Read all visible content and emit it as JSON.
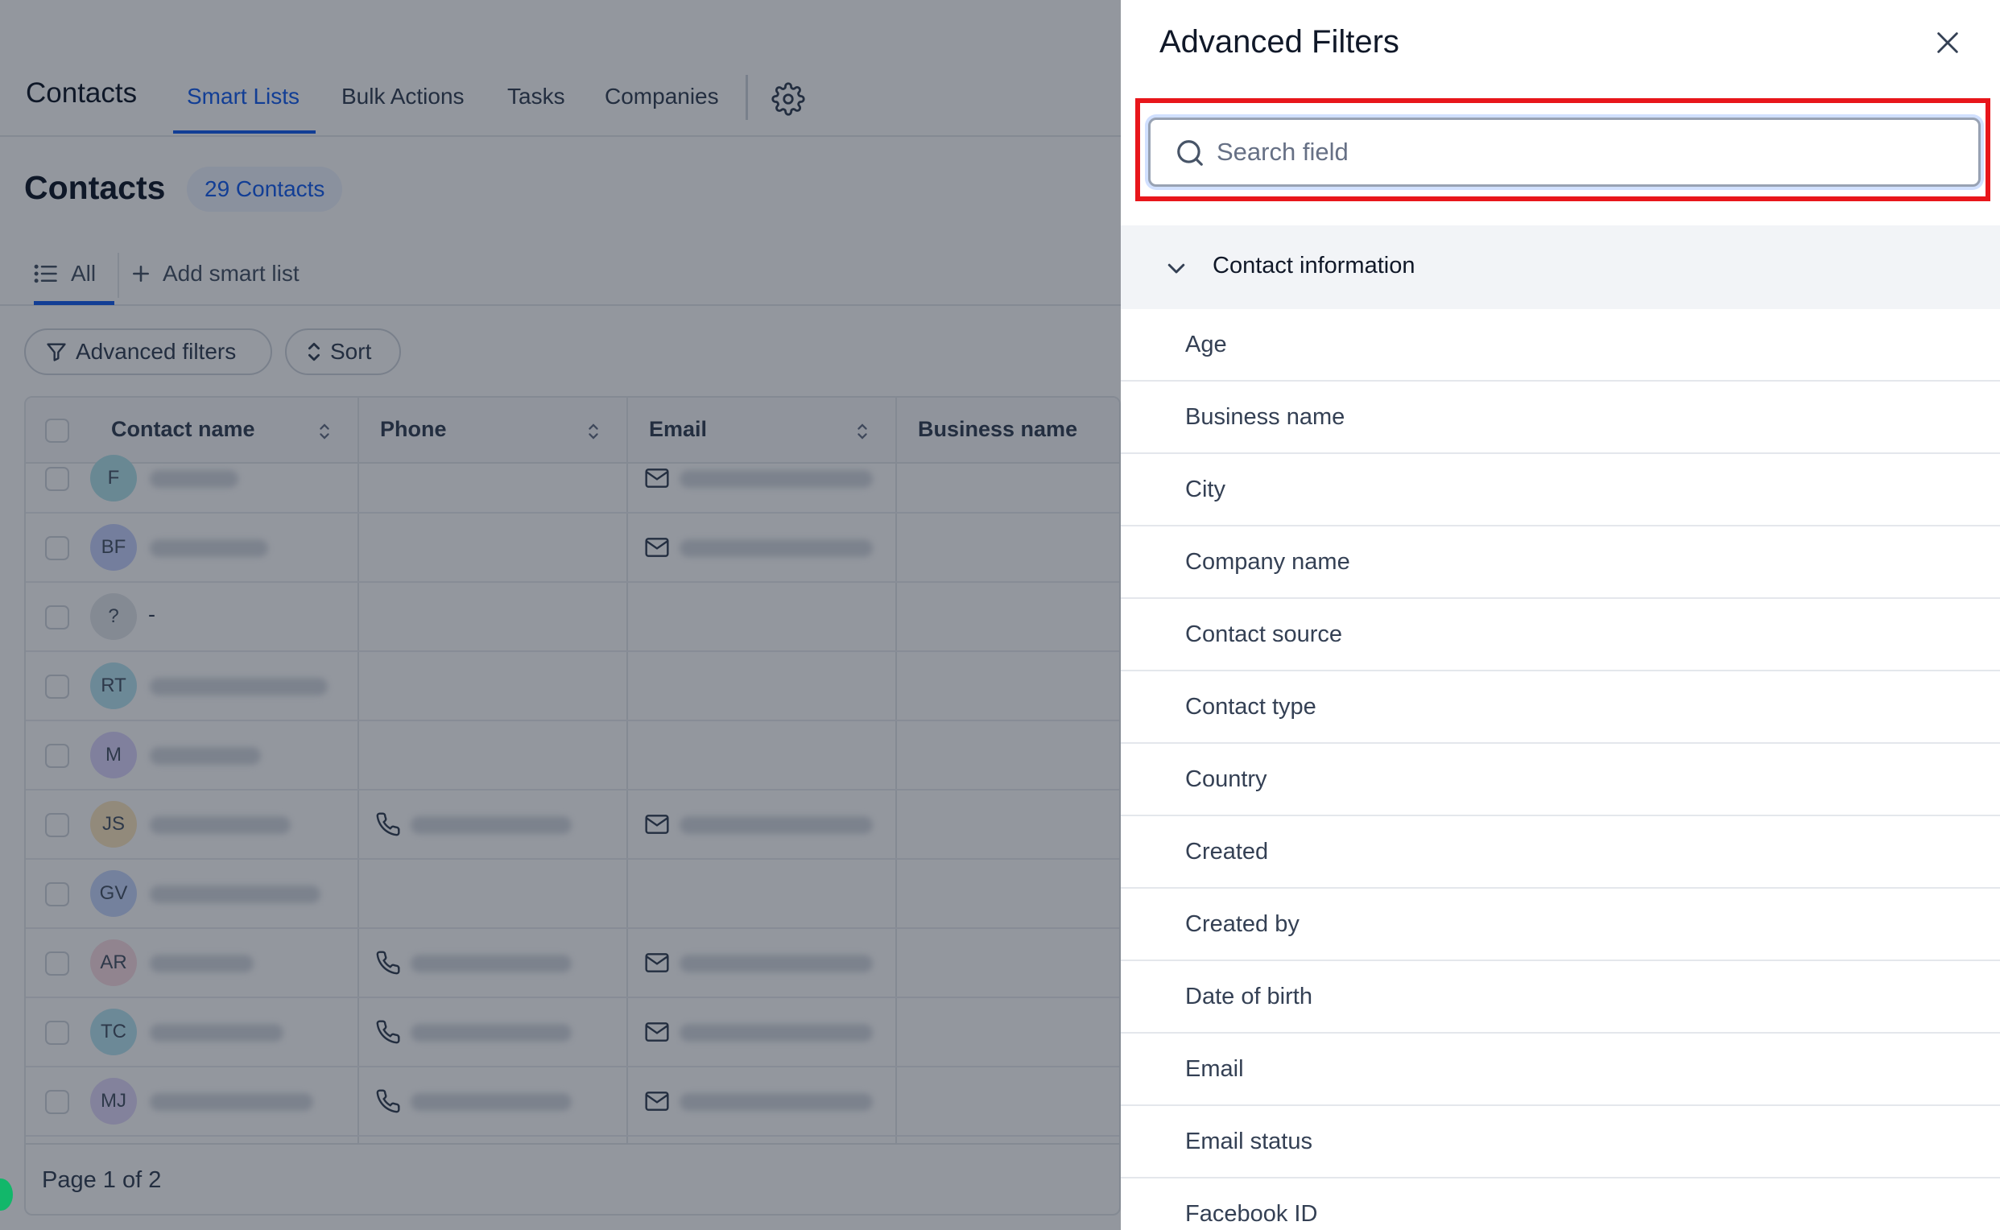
{
  "topnav": {
    "title": "Contacts",
    "tabs": [
      {
        "label": "Smart Lists",
        "active": true
      },
      {
        "label": "Bulk Actions"
      },
      {
        "label": "Tasks"
      },
      {
        "label": "Companies"
      }
    ],
    "settings_icon": "gear-icon"
  },
  "page": {
    "title": "Contacts",
    "count_badge": "29 Contacts"
  },
  "list_tabs": {
    "all_label": "All",
    "add_label": "Add smart list"
  },
  "toolbar": {
    "advanced_filters_label": "Advanced filters",
    "sort_label": "Sort"
  },
  "table": {
    "columns": [
      "Contact name",
      "Phone",
      "Email",
      "Business name"
    ],
    "rows": [
      {
        "initials": "F",
        "avatar_color": "#b3e3ec",
        "has_phone": false,
        "has_email": true
      },
      {
        "initials": "BF",
        "avatar_color": "#c7d2fe",
        "has_phone": false,
        "has_email": true
      },
      {
        "initials": "?",
        "avatar_color": "#e4e7ec",
        "name_text": "-",
        "has_phone": false,
        "has_email": false
      },
      {
        "initials": "RT",
        "avatar_color": "#b9e6f2",
        "has_phone": false,
        "has_email": false
      },
      {
        "initials": "M",
        "avatar_color": "#ddd6fe",
        "has_phone": false,
        "has_email": false
      },
      {
        "initials": "JS",
        "avatar_color": "#fde7c0",
        "has_phone": true,
        "has_email": true
      },
      {
        "initials": "GV",
        "avatar_color": "#c7d7fe",
        "has_phone": false,
        "has_email": false
      },
      {
        "initials": "AR",
        "avatar_color": "#fbdde3",
        "has_phone": true,
        "has_email": true
      },
      {
        "initials": "TC",
        "avatar_color": "#b9e6f2",
        "has_phone": true,
        "has_email": true
      },
      {
        "initials": "MJ",
        "avatar_color": "#e2d9fc",
        "has_phone": true,
        "has_email": true
      }
    ],
    "pagination": "Page 1 of 2"
  },
  "drawer": {
    "title": "Advanced Filters",
    "search_placeholder": "Search field",
    "search_value": "",
    "section_label": "Contact information",
    "fields": [
      "Age",
      "Business name",
      "City",
      "Company name",
      "Contact source",
      "Contact type",
      "Country",
      "Created",
      "Created by",
      "Date of birth",
      "Email",
      "Email status",
      "Facebook ID"
    ]
  },
  "colors": {
    "accent": "#155eef",
    "highlight": "#e8161b",
    "overlay": "#101828"
  }
}
